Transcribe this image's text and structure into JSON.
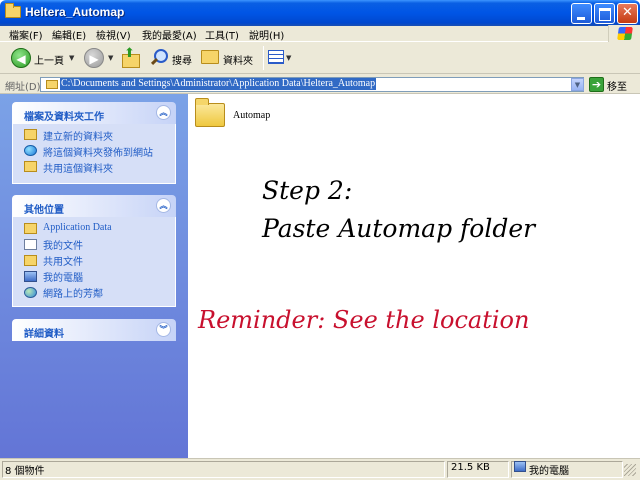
{
  "window": {
    "title": "Heltera_Automap"
  },
  "menu": {
    "items": [
      "檔案(F)",
      "編輯(E)",
      "檢視(V)",
      "我的最愛(A)",
      "工具(T)",
      "說明(H)"
    ]
  },
  "toolbar": {
    "back_label": "上一頁",
    "search_label": "搜尋",
    "folders_label": "資料夾"
  },
  "address": {
    "label": "網址(D)",
    "path": "C:\\Documents and Settings\\Administrator\\Application Data\\Heltera_Automap",
    "go_label": "移至"
  },
  "taskpane": {
    "file_tasks": {
      "title": "檔案及資料夾工作",
      "items": [
        "建立新的資料夾",
        "將這個資料夾發佈到網站",
        "共用這個資料夾"
      ]
    },
    "other_places": {
      "title": "其他位置",
      "items": [
        "Application Data",
        "我的文件",
        "共用文件",
        "我的電腦",
        "網路上的芳鄰"
      ]
    },
    "details": {
      "title": "詳細資料"
    }
  },
  "content": {
    "folder_name": "Automap",
    "step_line1": "Step 2:",
    "step_line2": "Paste Automap folder",
    "reminder": "Reminder: See the location"
  },
  "statusbar": {
    "objects": "8 個物件",
    "size": "21.5 KB",
    "location": "我的電腦"
  },
  "colors": {
    "titlebar": "#0055e5",
    "taskpane": "#6375d6",
    "link": "#215dc6",
    "reminder": "#c8102e",
    "selection": "#316ac5"
  }
}
